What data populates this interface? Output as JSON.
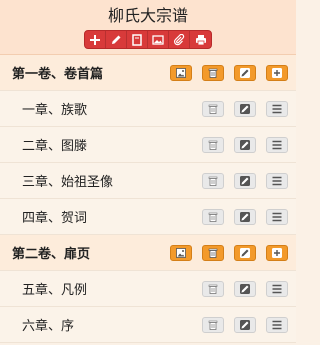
{
  "header": {
    "title": "柳氏大宗谱",
    "toolbar": [
      "add-icon",
      "edit-icon",
      "document-icon",
      "image-icon",
      "attach-icon",
      "print-icon"
    ]
  },
  "colors": {
    "toolbar_red": "#d83a3a",
    "orange_button": "#f39a2b",
    "gray_button": "#e9e9e9",
    "header_bg": "#fde3cf",
    "volume_bg": "#fdecdb",
    "chapter_bg": "#fbf3e9"
  },
  "volumes": [
    {
      "label": "第一卷、卷首篇",
      "chapters": [
        "一章、族歌",
        "二章、图滕",
        "三章、始祖圣像",
        "四章、贺词"
      ]
    },
    {
      "label": "第二卷、扉页",
      "chapters": [
        "五章、凡例",
        "六章、序"
      ]
    }
  ]
}
